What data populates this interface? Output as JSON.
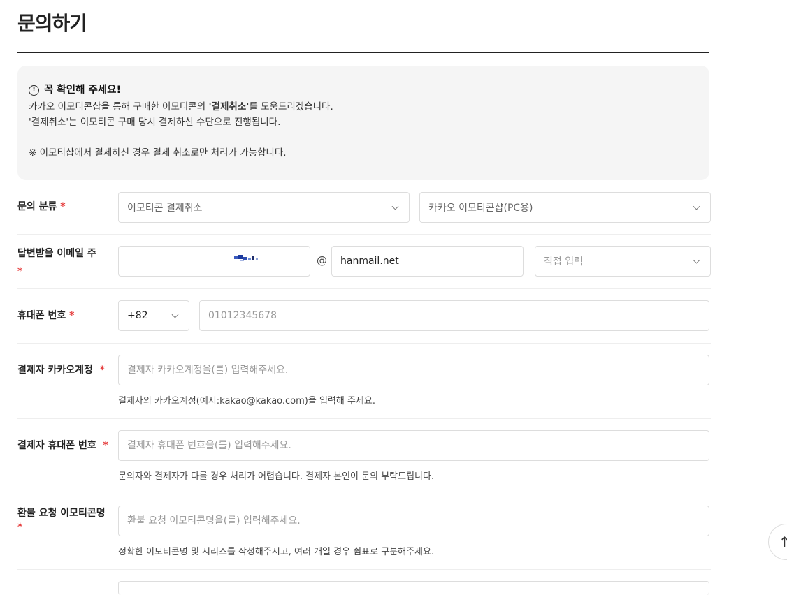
{
  "page": {
    "title": "문의하기"
  },
  "notice": {
    "heading": "꼭 확인해 주세요!",
    "line1_pre": "카카오 이모티콘샵을 통해 구매한 이모티콘의 ",
    "line1_bold": "'결제취소'",
    "line1_post": "를 도움드리겠습니다.",
    "line2": "'결제취소'는 이모티콘 구매 당시 결제하신 수단으로 진행됩니다.",
    "line3": "※ 이모티샵에서 결제하신 경우 결제 취소로만 처리가 가능합니다."
  },
  "form": {
    "category": {
      "label": "문의 분류",
      "required_mark": "*",
      "primary_value": "이모티콘 결제취소",
      "secondary_value": "카카오 이모티콘샵(PC용)"
    },
    "email": {
      "label": "답변받을 이메일 주소",
      "required_mark": "*",
      "at_sign": "@",
      "domain_value": "hanmail.net",
      "domain_select_placeholder": "직접 입력"
    },
    "phone": {
      "label": "휴대폰 번호",
      "required_mark": "*",
      "country_code": "+82",
      "number_placeholder": "01012345678"
    },
    "payer_account": {
      "label": "결제자 카카오계정",
      "required_mark": "*",
      "placeholder": "결제자 카카오계정을(를) 입력해주세요.",
      "helper": "결제자의 카카오계정(예시:kakao@kakao.com)을 입력해 주세요."
    },
    "payer_phone": {
      "label": "결제자 휴대폰 번호",
      "required_mark": "*",
      "placeholder": "결제자 휴대폰 번호을(를) 입력해주세요.",
      "helper": "문의자와 결제자가 다를 경우 처리가 어렵습니다. 결제자 본인이 문의 부탁드립니다."
    },
    "refund_emoticon": {
      "label": "환불 요청 이모티콘명",
      "required_mark": "*",
      "placeholder": "환불 요청 이모티콘명을(를) 입력해주세요.",
      "helper": "정확한 이모티콘명 및 시리즈를 작성해주시고, 여러 개일 경우 쉼표로 구분해주세요."
    }
  },
  "scroll_top": {
    "glyph": "↑"
  },
  "colors": {
    "required": "#e63d3d",
    "notice_bg": "#f5f5f5",
    "border": "#dddddd"
  }
}
